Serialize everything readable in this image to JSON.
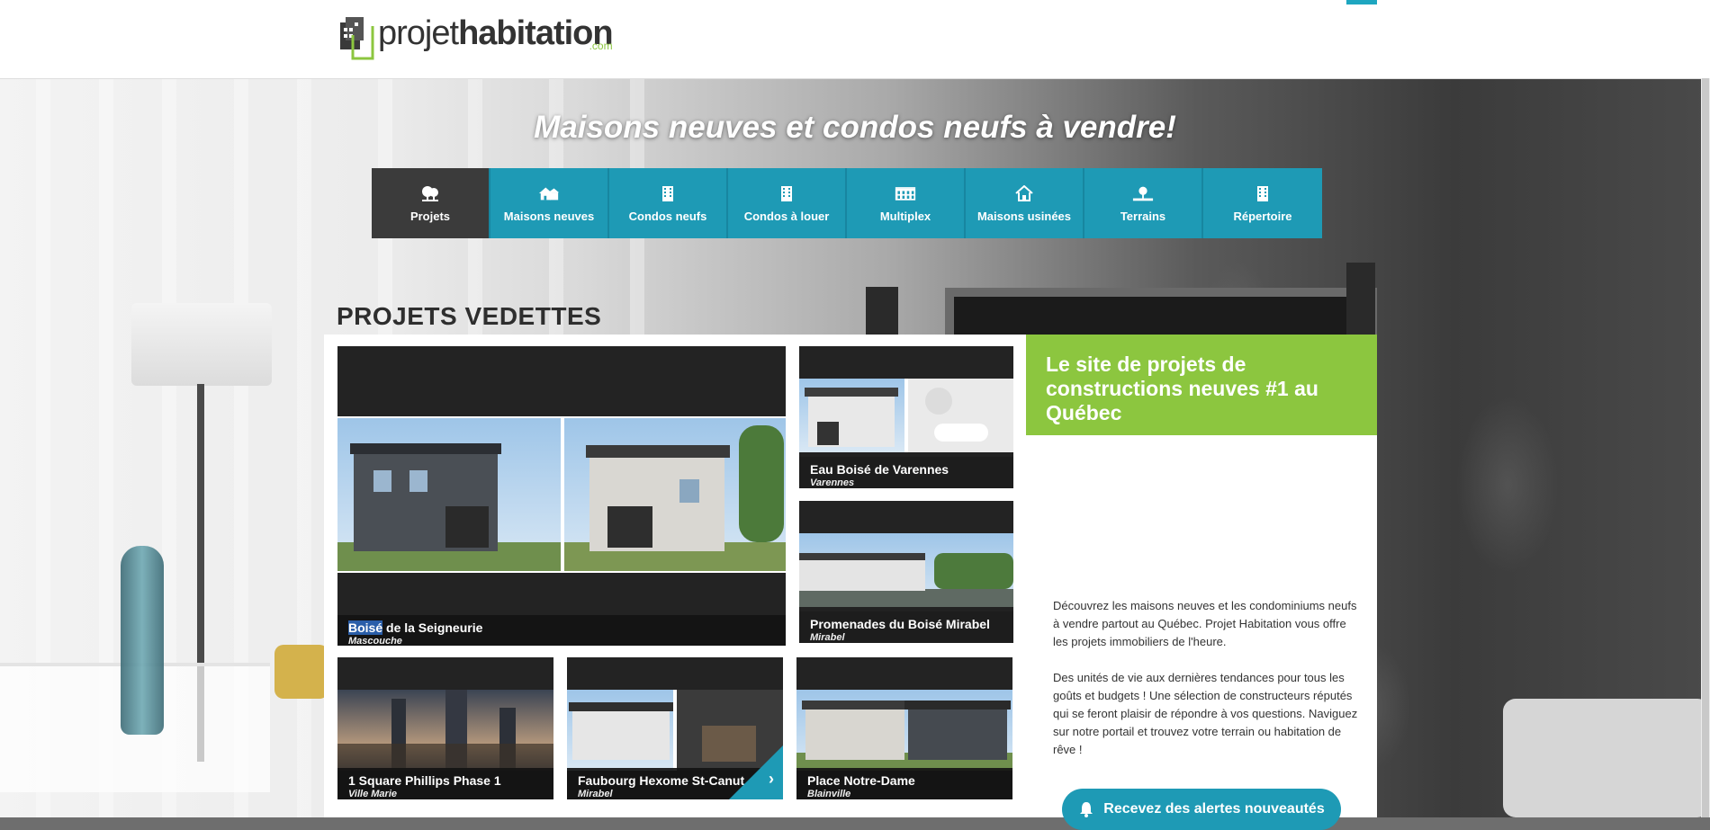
{
  "header": {
    "logo_light": "projet",
    "logo_bold": "habitation",
    "logo_com": ".com"
  },
  "hero": {
    "title": "Maisons neuves et condos neufs à vendre!"
  },
  "nav": [
    {
      "label": "Projets",
      "icon": "trees-icon",
      "active": true
    },
    {
      "label": "Maisons neuves",
      "icon": "houses-icon"
    },
    {
      "label": "Condos neufs",
      "icon": "building-icon"
    },
    {
      "label": "Condos à louer",
      "icon": "building-icon"
    },
    {
      "label": "Multiplex",
      "icon": "multiplex-icon"
    },
    {
      "label": "Maisons usinées",
      "icon": "home-icon"
    },
    {
      "label": "Terrains",
      "icon": "land-icon"
    },
    {
      "label": "Répertoire",
      "icon": "building-icon"
    }
  ],
  "featured": {
    "title": "PROJETS VEDETTES",
    "cards": [
      {
        "name_highlight": "Boisé",
        "name_rest": " de la Seigneurie",
        "city": "Mascouche"
      },
      {
        "name": "Eau Boisé de Varennes",
        "city": "Varennes"
      },
      {
        "name": "Promenades du Boisé Mirabel",
        "city": "Mirabel"
      },
      {
        "name": "1 Square Phillips Phase 1",
        "city": "Ville Marie"
      },
      {
        "name": "Faubourg Hexome St-Canut",
        "city": "Mirabel"
      },
      {
        "name": "Place Notre-Dame",
        "city": "Blainville"
      }
    ]
  },
  "info": {
    "title": "Le site de projets de constructions neuves #1 au Québec",
    "p1": "Découvrez les maisons neuves et les condominiums neufs à vendre partout au Québec. Projet Habitation vous offre les projets immobiliers de l'heure.",
    "p2": "Des unités de vie aux dernières tendances pour tous les goûts et budgets ! Une sélection de constructeurs réputés qui se feront plaisir de répondre à vos questions. Naviguez sur notre portail et trouvez votre terrain ou habitation de rêve !",
    "alert_label": "Recevez des alertes nouveautés"
  },
  "colors": {
    "accent_blue": "#1e9ab5",
    "accent_green": "#8cc63f",
    "nav_active": "#3b3b3b"
  }
}
